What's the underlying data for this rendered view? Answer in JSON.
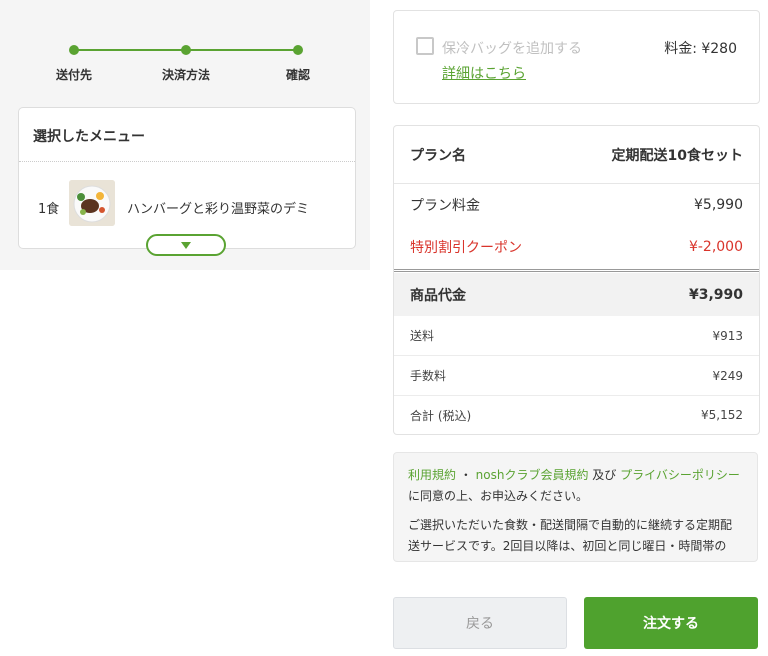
{
  "stepper": {
    "steps": [
      {
        "label": "送付先"
      },
      {
        "label": "決済方法"
      },
      {
        "label": "確認"
      }
    ]
  },
  "menu": {
    "title": "選択したメニュー",
    "items": [
      {
        "count": "1食",
        "name": "ハンバーグと彩り温野菜のデミ"
      }
    ]
  },
  "bag": {
    "label": "保冷バッグを追加する",
    "detail_link": "詳細はこちら",
    "price": "料金: ¥280",
    "checked": false
  },
  "summary": {
    "plan_label": "プラン名",
    "plan_value": "定期配送10食セット",
    "fee_label": "プラン料金",
    "fee_value": "¥5,990",
    "coupon_label": "特別割引クーポン",
    "coupon_value": "¥-2,000",
    "goods_label": "商品代金",
    "goods_value": "¥3,990",
    "shipping_label": "送料",
    "shipping_value": "¥913",
    "handling_label": "手数料",
    "handling_value": "¥249",
    "total_label": "合計 (税込)",
    "total_value": "¥5,152"
  },
  "terms": {
    "link1": "利用規約",
    "sep": " ・ ",
    "link2": "noshクラブ会員規約",
    "and": " 及び ",
    "link3": "プライバシーポリシー",
    "agree": " に同意の上、お申込みください。",
    "note": "ご選択いただいた食数・配送間隔で自動的に継続する定期配送サービスです。2回目以降は、初回と同じ曜日・時間帯の"
  },
  "buttons": {
    "back": "戻る",
    "order": "注文する"
  },
  "colors": {
    "accent": "#5aa332",
    "discount": "#d9342b",
    "order_button": "#4fa22e"
  }
}
